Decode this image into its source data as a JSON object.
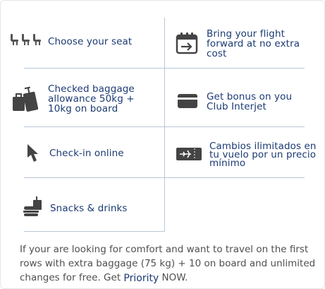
{
  "features": [
    {
      "label": "Choose your seat",
      "icon": "seats-icon"
    },
    {
      "label": "Bring your flight forward at no extra cost",
      "icon": "calendar-arrow-icon"
    },
    {
      "label": "Checked baggage allowance 50kg + 10kg on board",
      "icon": "baggage-icon"
    },
    {
      "label": "Get bonus on you Club Interjet",
      "icon": "card-icon"
    },
    {
      "label": "Check-in online",
      "icon": "cursor-icon"
    },
    {
      "label": "Cambios ilimitados en tu vuelo por un precio mínimo",
      "icon": "ticket-plane-icon"
    },
    {
      "label": "Snacks & drinks",
      "icon": "snack-drink-icon"
    }
  ],
  "footer": {
    "text_before": "If your are looking for comfort and want to travel on the first rows with extra baggage (75 kg) + 10 on board and unlimited changes for free. Get ",
    "priority": "Priority",
    "text_after": " NOW."
  },
  "colors": {
    "text": "#1b3a73",
    "icon": "#444444",
    "divider": "#b9c7d6",
    "footer": "#4f4f4f"
  }
}
